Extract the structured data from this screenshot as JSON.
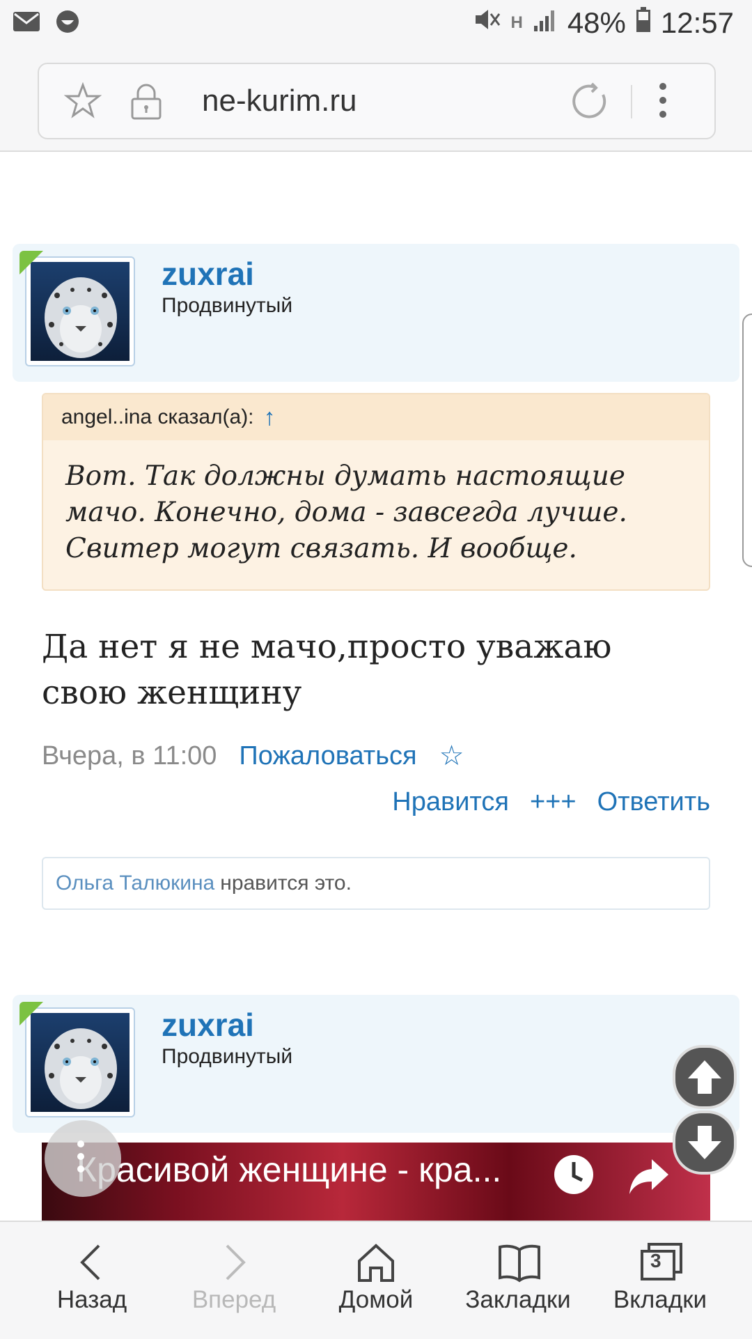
{
  "status_bar": {
    "battery": "48%",
    "time": "12:57",
    "network": "H"
  },
  "browser": {
    "url": "ne-kurim.ru"
  },
  "posts": [
    {
      "username": "zuxrai",
      "rank": "Продвинутый",
      "quote": {
        "author": "angel..ina сказал(а):",
        "arrow": "↑",
        "lines": [
          "Вот. Так должны думать настоящие",
          "мачо. Конечно, дома - завсегда лучше.",
          "Свитер могут связать. И вообще."
        ]
      },
      "message_lines": [
        "Да нет я не мачо,просто уважаю",
        "свою женщину"
      ],
      "date": "Вчера, в 11:00",
      "report_label": "Пожаловаться",
      "star": "☆",
      "actions": [
        "Нравится",
        "+++",
        "Ответить"
      ],
      "likes": {
        "who": "Ольга Талюкина",
        "text": "нравится это."
      }
    },
    {
      "username": "zuxrai",
      "rank": "Продвинутый"
    }
  ],
  "video": {
    "title": "Красивой женщине - кра..."
  },
  "bottom_nav": [
    {
      "label": "Назад",
      "icon": "back-arrow-icon",
      "enabled": true
    },
    {
      "label": "Вперед",
      "icon": "forward-arrow-icon",
      "enabled": false
    },
    {
      "label": "Домой",
      "icon": "home-icon",
      "enabled": true
    },
    {
      "label": "Закладки",
      "icon": "bookmarks-icon",
      "enabled": true
    },
    {
      "label": "Вкладки",
      "icon": "tabs-icon",
      "enabled": true,
      "badge": "3"
    }
  ]
}
